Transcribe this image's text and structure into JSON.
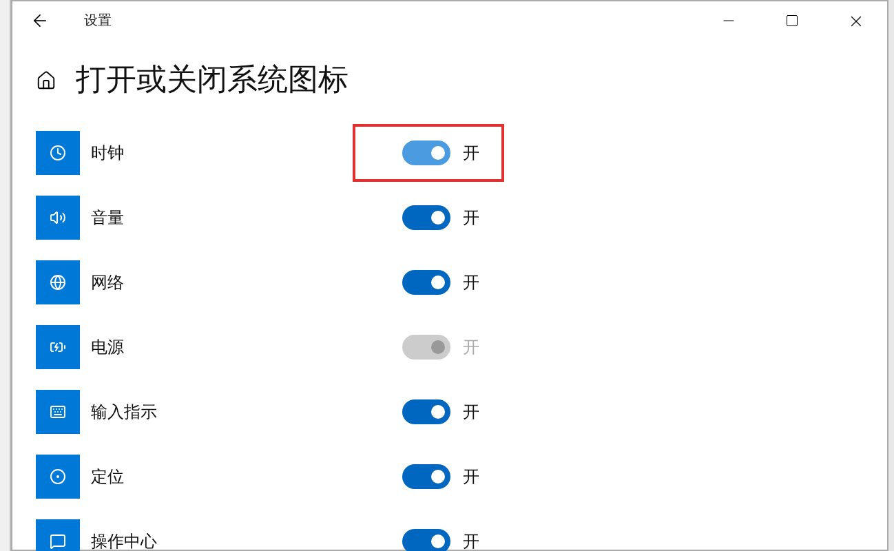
{
  "window": {
    "title": "设置"
  },
  "heading": "打开或关闭系统图标",
  "items": [
    {
      "label": "时钟",
      "on": true,
      "disabled": false,
      "highlighted": true,
      "state_label": "开"
    },
    {
      "label": "音量",
      "on": true,
      "disabled": false,
      "highlighted": false,
      "state_label": "开"
    },
    {
      "label": "网络",
      "on": true,
      "disabled": false,
      "highlighted": false,
      "state_label": "开"
    },
    {
      "label": "电源",
      "on": true,
      "disabled": true,
      "highlighted": false,
      "state_label": "开"
    },
    {
      "label": "输入指示",
      "on": true,
      "disabled": false,
      "highlighted": false,
      "state_label": "开"
    },
    {
      "label": "定位",
      "on": true,
      "disabled": false,
      "highlighted": false,
      "state_label": "开"
    },
    {
      "label": "操作中心",
      "on": true,
      "disabled": false,
      "highlighted": false,
      "state_label": "开"
    }
  ]
}
